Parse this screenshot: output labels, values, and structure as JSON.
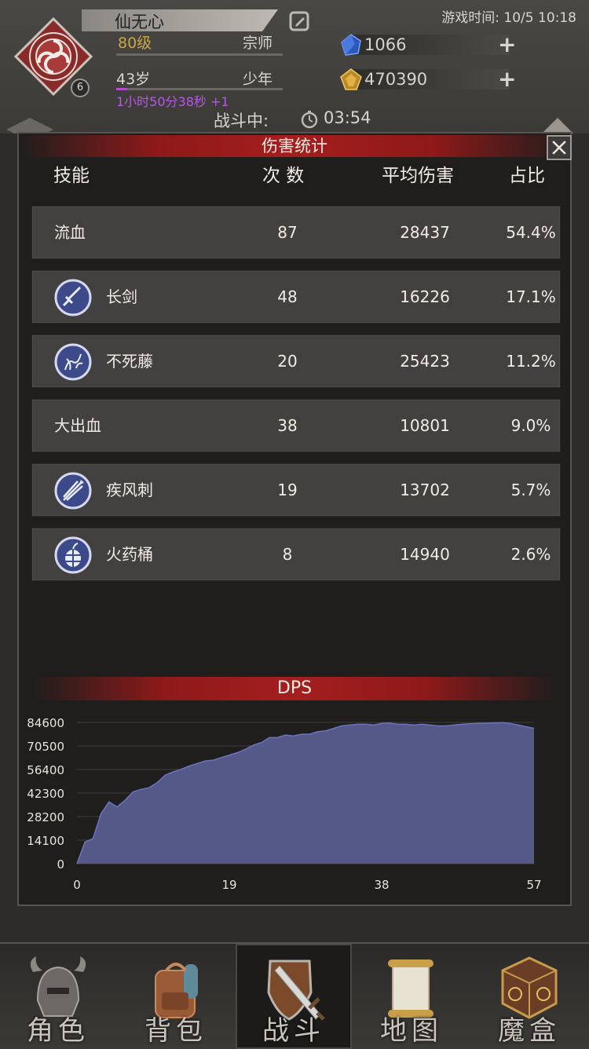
{
  "header": {
    "name": "仙无心",
    "level": "80级",
    "rank": "宗师",
    "age": "43岁",
    "life_stage": "少年",
    "timer": "1小时50分38秒 +1",
    "level_badge": "6",
    "game_time": "游戏时间: 10/5 10:18",
    "resources": [
      {
        "icon": "blue-gem-icon",
        "value": "1066"
      },
      {
        "icon": "gold-gem-icon",
        "value": "470390"
      }
    ],
    "battle_label": "战斗中:",
    "countdown": "03:54"
  },
  "dialog": {
    "title": "伤害统计",
    "columns": {
      "skill": "技能",
      "count": "次 数",
      "avg": "平均伤害",
      "pct": "占比"
    },
    "rows": [
      {
        "name": "流血",
        "count": "87",
        "avg": "28437",
        "pct": "54.4%",
        "icon": ""
      },
      {
        "name": "长剑",
        "count": "48",
        "avg": "16226",
        "pct": "17.1%",
        "icon": "sword-icon"
      },
      {
        "name": "不死藤",
        "count": "20",
        "avg": "25423",
        "pct": "11.2%",
        "icon": "vine-icon"
      },
      {
        "name": "大出血",
        "count": "38",
        "avg": "10801",
        "pct": "9.0%",
        "icon": ""
      },
      {
        "name": "疾风刺",
        "count": "19",
        "avg": "13702",
        "pct": "5.7%",
        "icon": "gale-stab-icon"
      },
      {
        "name": "火药桶",
        "count": "8",
        "avg": "14940",
        "pct": "2.6%",
        "icon": "powder-keg-icon"
      }
    ],
    "dps_title": "DPS"
  },
  "chart_data": {
    "type": "area",
    "title": "DPS",
    "yticks": [
      "84600",
      "70500",
      "56400",
      "42300",
      "28200",
      "14100",
      "0"
    ],
    "xticks": [
      "0",
      "19",
      "38",
      "57"
    ],
    "xlim": [
      0,
      57
    ],
    "ylim": [
      0,
      84600
    ],
    "grid": true,
    "color": "#5a5f93",
    "line_color": "#6c74c2",
    "x": [
      0,
      1,
      2,
      3,
      4,
      5,
      6,
      7,
      8,
      9,
      10,
      11,
      12,
      13,
      14,
      15,
      16,
      17,
      18,
      19,
      20,
      21,
      22,
      23,
      24,
      25,
      26,
      27,
      28,
      29,
      30,
      31,
      32,
      33,
      34,
      35,
      36,
      37,
      38,
      39,
      40,
      41,
      42,
      43,
      44,
      45,
      46,
      47,
      48,
      49,
      50,
      51,
      52,
      53,
      54,
      55,
      56,
      57
    ],
    "y": [
      0,
      13000,
      15000,
      30000,
      37000,
      34000,
      38000,
      43000,
      44500,
      45500,
      48500,
      53000,
      55000,
      56500,
      58500,
      60000,
      61500,
      62000,
      63500,
      65000,
      66500,
      68500,
      71000,
      72500,
      75500,
      75500,
      77000,
      76500,
      77500,
      77500,
      79000,
      79500,
      81000,
      82500,
      83000,
      83500,
      83500,
      83000,
      84000,
      84200,
      83500,
      83500,
      83000,
      83500,
      83000,
      82500,
      82500,
      83000,
      83500,
      83800,
      84000,
      84100,
      84300,
      84400,
      84000,
      83000,
      82000,
      81000
    ]
  },
  "nav": [
    {
      "label": "角色",
      "icon": "helmet-icon",
      "active": false
    },
    {
      "label": "背包",
      "icon": "backpack-icon",
      "active": false
    },
    {
      "label": "战斗",
      "icon": "sword-shield-icon",
      "active": true
    },
    {
      "label": "地图",
      "icon": "scroll-map-icon",
      "active": false
    },
    {
      "label": "魔盒",
      "icon": "magic-box-icon",
      "active": false
    }
  ]
}
